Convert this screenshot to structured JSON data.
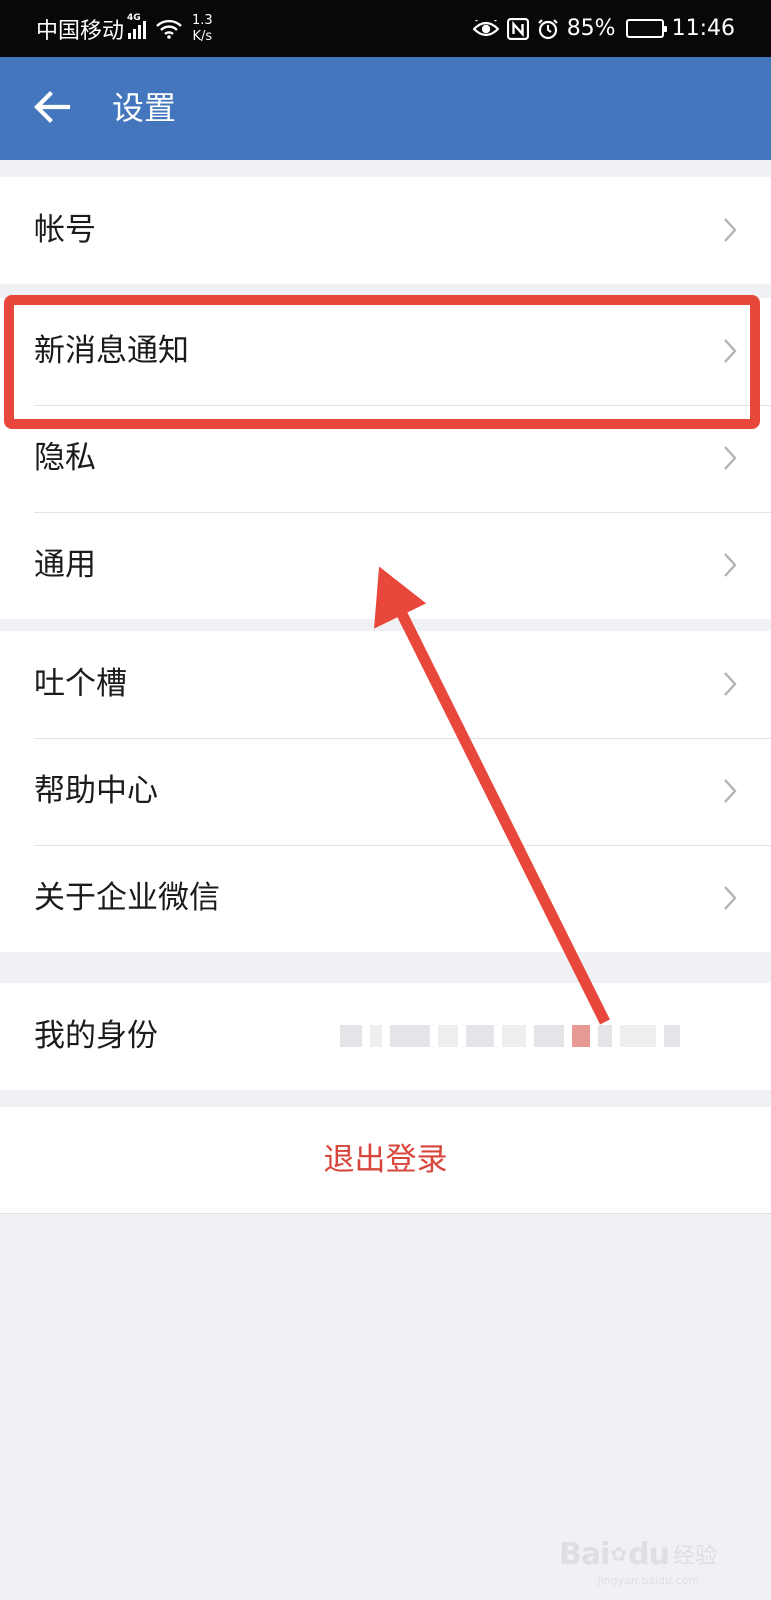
{
  "status_bar": {
    "carrier": "中国移动",
    "network_type": "4G",
    "net_speed_value": "1.3",
    "net_speed_unit": "K/s",
    "battery_percent": "85%",
    "battery_level": 0.85,
    "time": "11:46",
    "icons": [
      "signal-icon",
      "wifi-icon",
      "eye-icon",
      "nfc-icon",
      "alarm-icon",
      "battery-icon"
    ]
  },
  "header": {
    "back_icon": "arrow-left",
    "title": "设置"
  },
  "settings_groups": [
    {
      "items": [
        {
          "label": "帐号"
        }
      ]
    },
    {
      "items": [
        {
          "label": "新消息通知"
        },
        {
          "label": "隐私"
        },
        {
          "label": "通用"
        }
      ]
    },
    {
      "items": [
        {
          "label": "吐个槽"
        },
        {
          "label": "帮助中心"
        },
        {
          "label": "关于企业微信"
        }
      ]
    },
    {
      "items": [
        {
          "label": "我的身份"
        }
      ]
    }
  ],
  "logout": {
    "label": "退出登录"
  },
  "colors": {
    "header_bg": "#4376bd",
    "status_bar_bg": "#080808",
    "page_bg": "#f0f1f4",
    "logout_text": "#d8453a",
    "annotation": "#e8473c"
  },
  "watermark": {
    "brand": "Bai",
    "brand_suffix": "du",
    "suffix": "经验",
    "url": "jingyan.baidu.com"
  }
}
